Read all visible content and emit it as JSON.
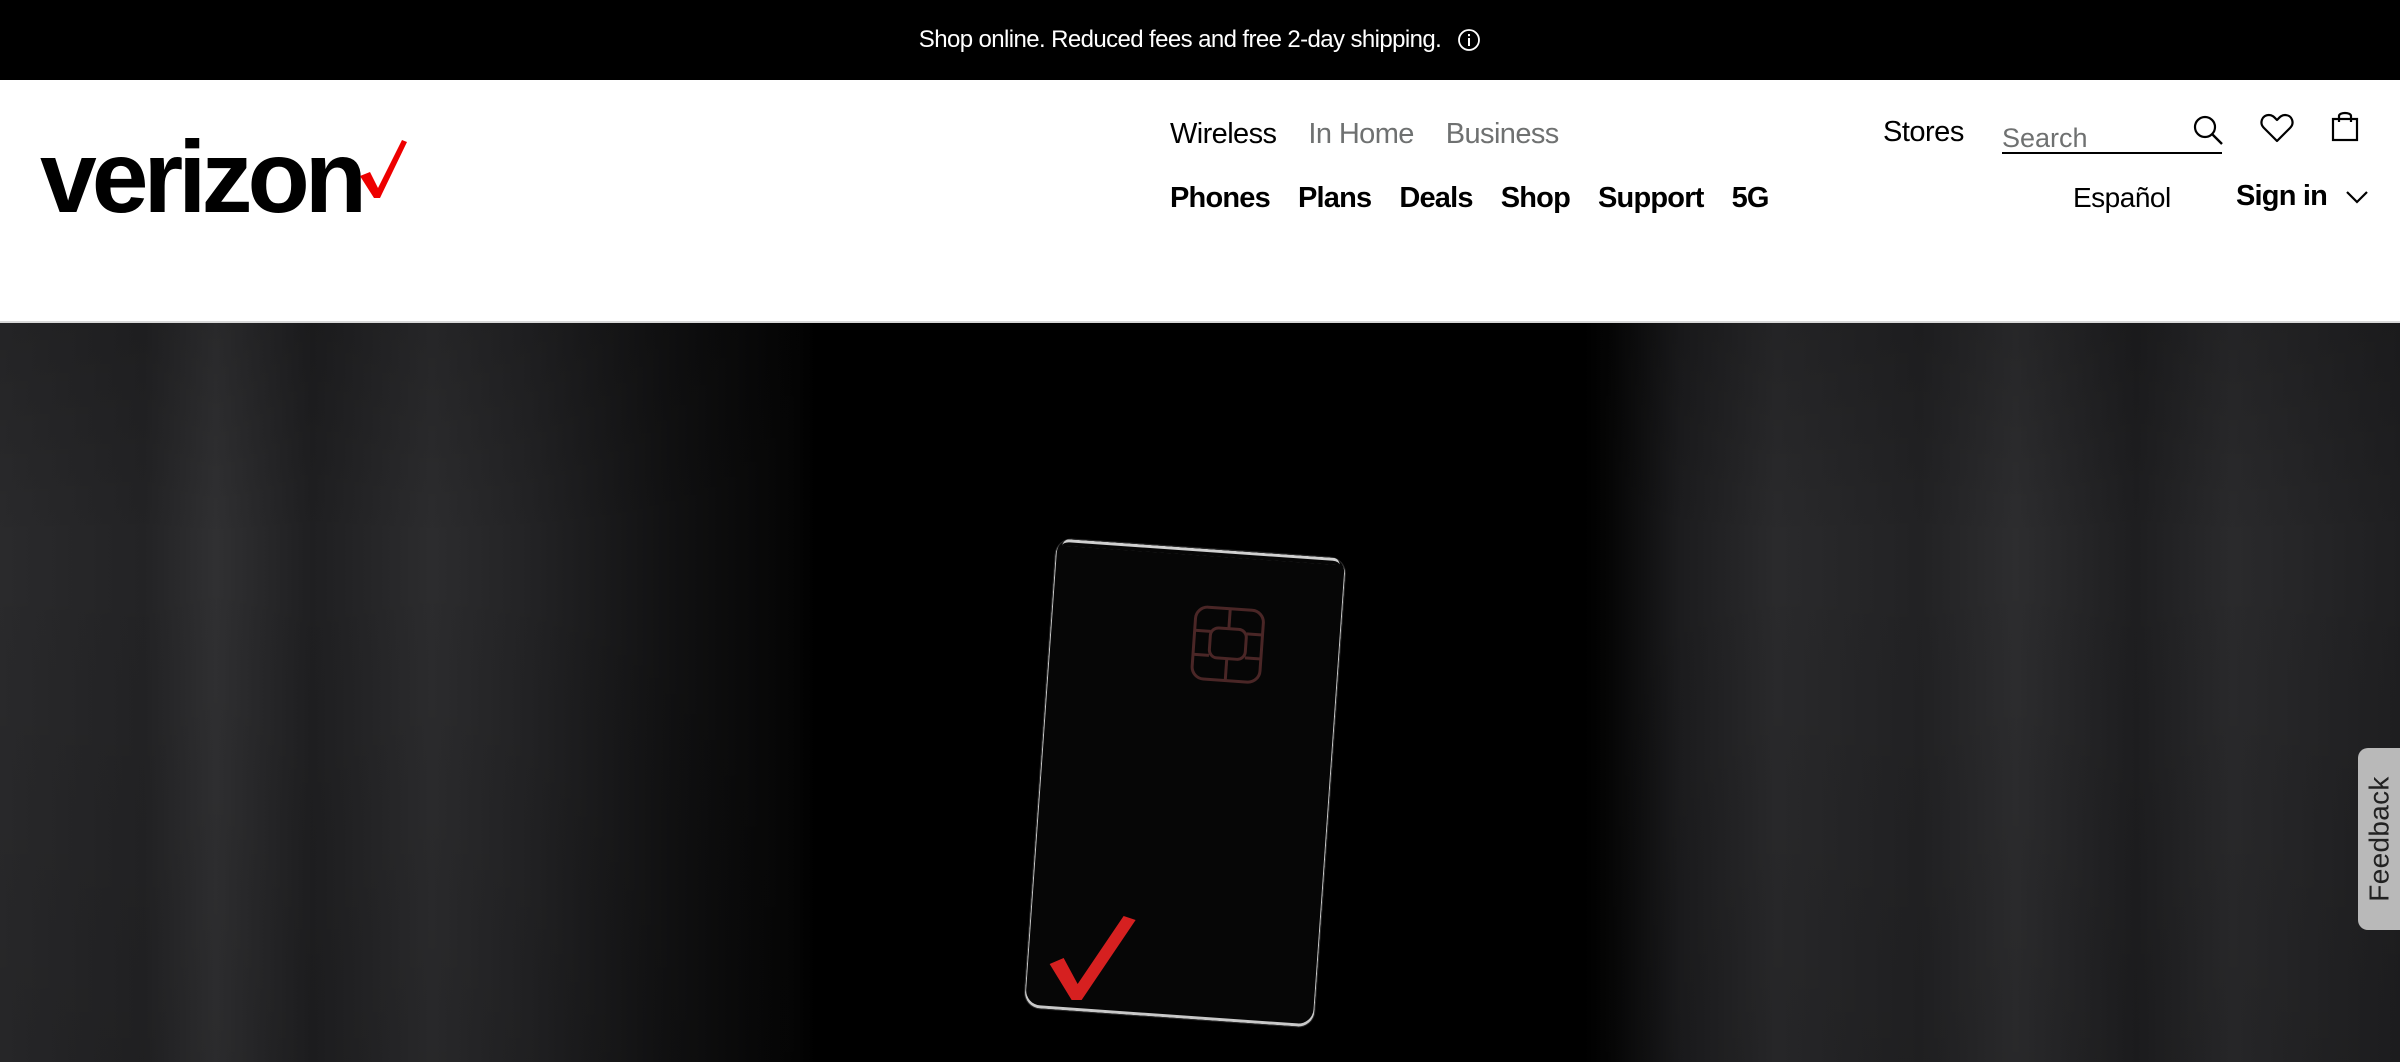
{
  "topbar": {
    "message": "Shop online. Reduced fees and free 2-day shipping.",
    "info_icon": "info-icon"
  },
  "header": {
    "logo_text": "verizon",
    "brand_color": "#ee0000",
    "nav_top": [
      {
        "label": "Wireless",
        "active": true
      },
      {
        "label": "In Home",
        "active": false
      },
      {
        "label": "Business",
        "active": false
      }
    ],
    "nav_main": [
      "Phones",
      "Plans",
      "Deals",
      "Shop",
      "Support",
      "5G"
    ],
    "stores_label": "Stores",
    "search": {
      "placeholder": "Search",
      "value": ""
    },
    "icons": [
      "search-icon",
      "heart-icon",
      "shopping-bag-icon",
      "chevron-down-icon"
    ],
    "espanol_label": "Español",
    "signin_label": "Sign in"
  },
  "feedback": {
    "label": "Feedback"
  }
}
